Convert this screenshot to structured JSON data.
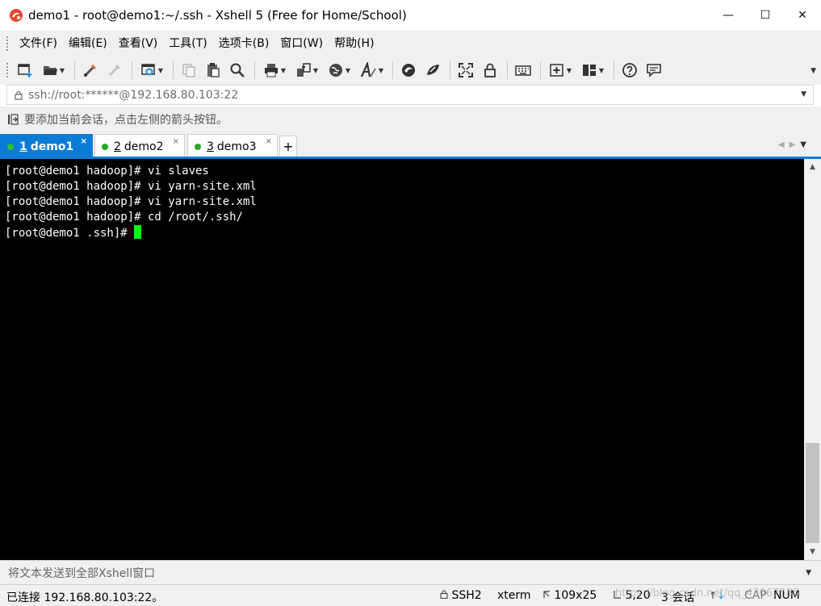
{
  "window": {
    "title": "demo1 - root@demo1:~/.ssh - Xshell 5 (Free for Home/School)",
    "controls": {
      "minimize": "—",
      "maximize": "☐",
      "close": "✕"
    }
  },
  "menu": {
    "items": [
      {
        "label": "文件(F)"
      },
      {
        "label": "编辑(E)"
      },
      {
        "label": "查看(V)"
      },
      {
        "label": "工具(T)"
      },
      {
        "label": "选项卡(B)"
      },
      {
        "label": "窗口(W)"
      },
      {
        "label": "帮助(H)"
      }
    ]
  },
  "toolbar": {
    "icons": [
      "new-session-icon",
      "open-folder-icon",
      "reconnect-icon",
      "disconnect-icon",
      "properties-icon",
      "copy-icon",
      "paste-icon",
      "find-icon",
      "print-icon",
      "transfer-icon",
      "globe-icon",
      "font-icon",
      "xftp-icon",
      "xagent-icon",
      "fullscreen-icon",
      "lock-icon",
      "keyboard-icon",
      "new-tab-icon",
      "layout-icon",
      "help-icon",
      "chat-icon"
    ]
  },
  "address": {
    "value": "ssh://root:******@192.168.80.103:22"
  },
  "hint": {
    "text": "要添加当前会话，点击左侧的箭头按钮。"
  },
  "tabs": [
    {
      "num": "1",
      "label": "demo1",
      "active": true
    },
    {
      "num": "2",
      "label": "demo2",
      "active": false
    },
    {
      "num": "3",
      "label": "demo3",
      "active": false
    }
  ],
  "tab_close": "×",
  "tab_add": "+",
  "terminal": {
    "lines": [
      "[root@demo1 hadoop]# vi slaves",
      "[root@demo1 hadoop]# vi yarn-site.xml",
      "[root@demo1 hadoop]# vi yarn-site.xml",
      "[root@demo1 hadoop]# cd /root/.ssh/",
      "[root@demo1 .ssh]# "
    ]
  },
  "sendbar": {
    "placeholder": "将文本发送到全部Xshell窗口"
  },
  "status": {
    "connection": "已连接 192.168.80.103:22。",
    "protocol": "SSH2",
    "terminal": "xterm",
    "size": "109x25",
    "cursor": "5,20",
    "sessions": "3 会话",
    "caps": "CAP",
    "num": "NUM"
  },
  "watermark": "https://blog.csdn.net/qq_43067585",
  "colors": {
    "accent": "#0a7cd8",
    "terminal_bg": "#000000",
    "cursor": "#00ff00"
  }
}
